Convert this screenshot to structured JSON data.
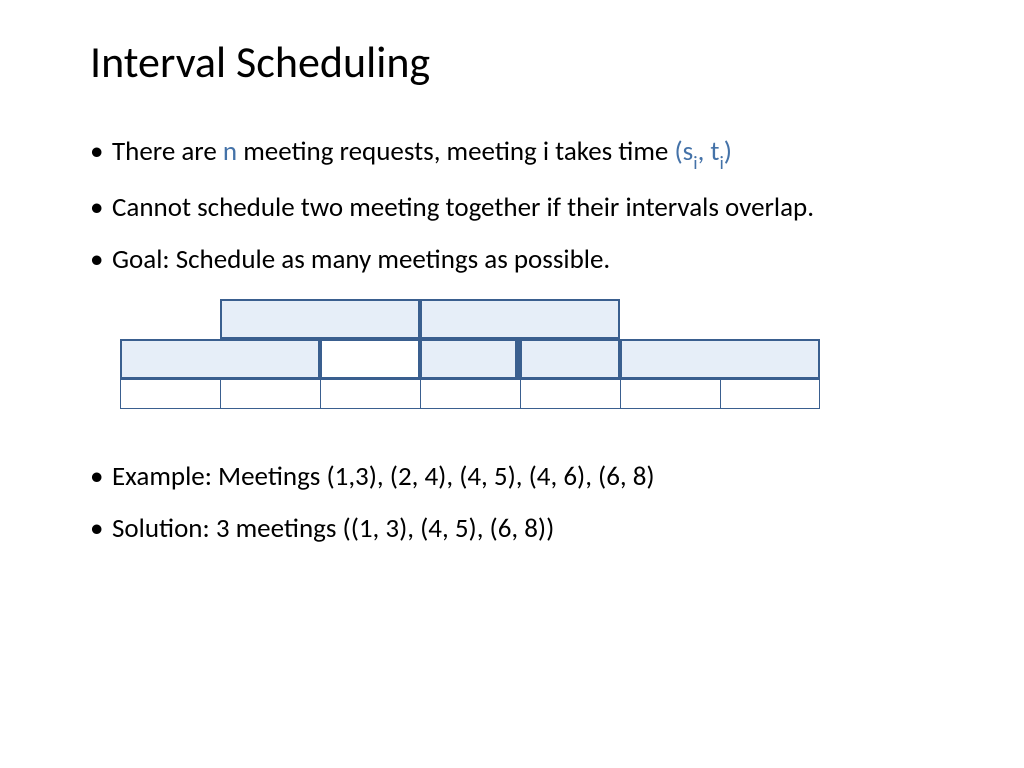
{
  "title": "Interval Scheduling",
  "bullets": {
    "b1_pre": "There are ",
    "b1_n": "n",
    "b1_mid": " meeting requests, meeting i takes time ",
    "b1_interval_open": "(s",
    "b1_sub1": "i",
    "b1_comma": ", t",
    "b1_sub2": "i",
    "b1_close": ")",
    "b2": "Cannot schedule two meeting together if their intervals overlap.",
    "b3": "Goal: Schedule as many meetings as possible.",
    "b4": "Example: Meetings (1,3), (2, 4), (4, 5), (4, 6), (6, 8)",
    "b5": "Solution: 3 meetings ((1, 3), (4, 5), (6, 8))"
  },
  "diagram": {
    "unit": 100,
    "origin": 0,
    "timeline_start": 1,
    "timeline_end": 8,
    "top_bars": [
      {
        "start": 2,
        "end": 4
      },
      {
        "start": 4,
        "end": 6
      }
    ],
    "mid_bars": [
      {
        "start": 1,
        "end": 3
      },
      {
        "start": 3,
        "end": 4,
        "white": true
      },
      {
        "start": 4,
        "end": 5,
        "thick": true
      },
      {
        "start": 5,
        "end": 6
      },
      {
        "start": 6,
        "end": 8
      }
    ],
    "ticks": [
      1,
      2,
      3,
      4,
      5,
      6,
      7,
      8
    ]
  }
}
